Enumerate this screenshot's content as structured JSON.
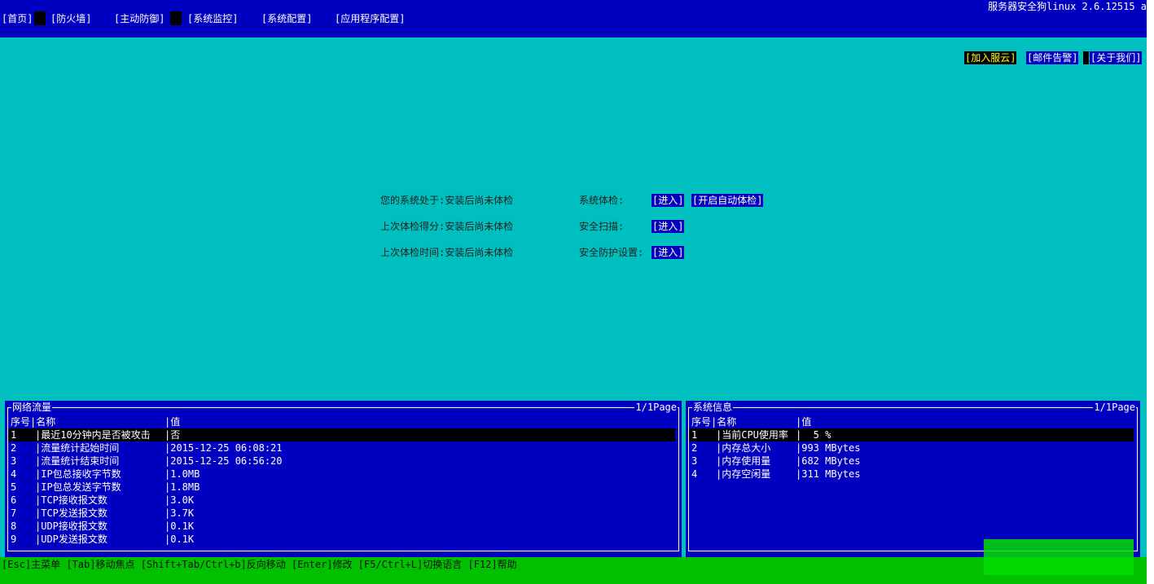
{
  "menu": {
    "items": [
      "[首页]",
      "[防火墙]",
      "[主动防御]",
      "[系统监控]",
      "[系统配置]",
      "[应用程序配置]"
    ]
  },
  "app_title": "服务器安全狗linux 2.6.12515 a",
  "top_buttons": [
    "[加入服云]",
    "[邮件告警]",
    "[关于我们]"
  ],
  "status_block": {
    "rows": [
      {
        "label": "您的系统处于:安装后尚未体检",
        "action_label": "系统体检:",
        "buttons": [
          "[进入]",
          "[开启自动体检]"
        ]
      },
      {
        "label": "上次体检得分:安装后尚未体检",
        "action_label": "安全扫描:",
        "buttons": [
          "[进入]"
        ]
      },
      {
        "label": "上次体检时间:安装后尚未体检",
        "action_label": "安全防护设置:",
        "buttons": [
          "[进入]"
        ]
      }
    ]
  },
  "network_panel": {
    "title": "网络流量",
    "page": "1/1Page",
    "columns": [
      "序号|名称",
      "|值"
    ],
    "rows": [
      {
        "num": "1",
        "name": "|最近10分钟内是否被攻击",
        "value": "|否"
      },
      {
        "num": "2",
        "name": "|流量统计起始时间",
        "value": "|2015-12-25 06:08:21"
      },
      {
        "num": "3",
        "name": "|流量统计结束时间",
        "value": "|2015-12-25 06:56:20"
      },
      {
        "num": "4",
        "name": "|IP包总接收字节数",
        "value": "|1.0MB"
      },
      {
        "num": "5",
        "name": "|IP包总发送字节数",
        "value": "|1.8MB"
      },
      {
        "num": "6",
        "name": "|TCP接收报文数",
        "value": "|3.0K"
      },
      {
        "num": "7",
        "name": "|TCP发送报文数",
        "value": "|3.7K"
      },
      {
        "num": "8",
        "name": "|UDP接收报文数",
        "value": "|0.1K"
      },
      {
        "num": "9",
        "name": "|UDP发送报文数",
        "value": "|0.1K"
      }
    ]
  },
  "system_panel": {
    "title": "系统信息",
    "page": "1/1Page",
    "columns": [
      "序号|名称",
      "|值"
    ],
    "rows": [
      {
        "num": "1",
        "name": "|当前CPU使用率",
        "value": "|  5 %"
      },
      {
        "num": "2",
        "name": "|内存总大小",
        "value": "|993 MBytes"
      },
      {
        "num": "3",
        "name": "|内存使用量",
        "value": "|682 MBytes"
      },
      {
        "num": "4",
        "name": "|内存空闲量",
        "value": "|311 MBytes"
      }
    ]
  },
  "status_bar": "[Esc]主菜单 [Tab]移动焦点 [Shift+Tab/Ctrl+b]反向移动 [Enter]修改 [F5/Ctrl+L]切换语言 [F12]帮助",
  "colors": {
    "background": "#00bfbf",
    "bar_blue": "#0000c0",
    "status_green": "#00c000",
    "highlight_button": "#000000",
    "highlight_text": "#ffff00"
  }
}
